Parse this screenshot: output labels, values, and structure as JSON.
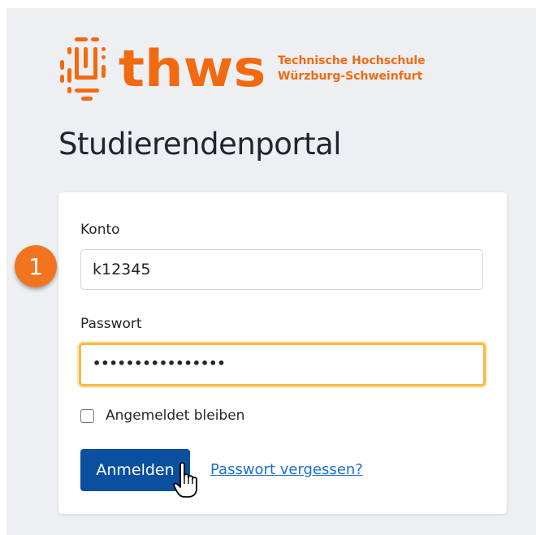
{
  "branding": {
    "logo_word": "thws",
    "subtitle_line1": "Technische Hochschule",
    "subtitle_line2": "Würzburg-Schweinfurt",
    "brand_color": "#f26a10"
  },
  "page": {
    "title": "Studierendenportal"
  },
  "form": {
    "account_label": "Konto",
    "account_value": "k12345",
    "password_label": "Passwort",
    "password_value": "••••••••••••••••",
    "remember_label": "Angemeldet bleiben",
    "remember_checked": false,
    "submit_label": "Anmelden",
    "forgot_link": "Passwort vergessen?",
    "primary_color": "#0b4f9f",
    "focus_color": "#f5b942"
  },
  "annotation": {
    "step_number": "1",
    "badge_color": "#f2741f"
  },
  "icons": {
    "logo_mark": "thws-logo-icon",
    "cursor": "hand-pointer-icon"
  }
}
